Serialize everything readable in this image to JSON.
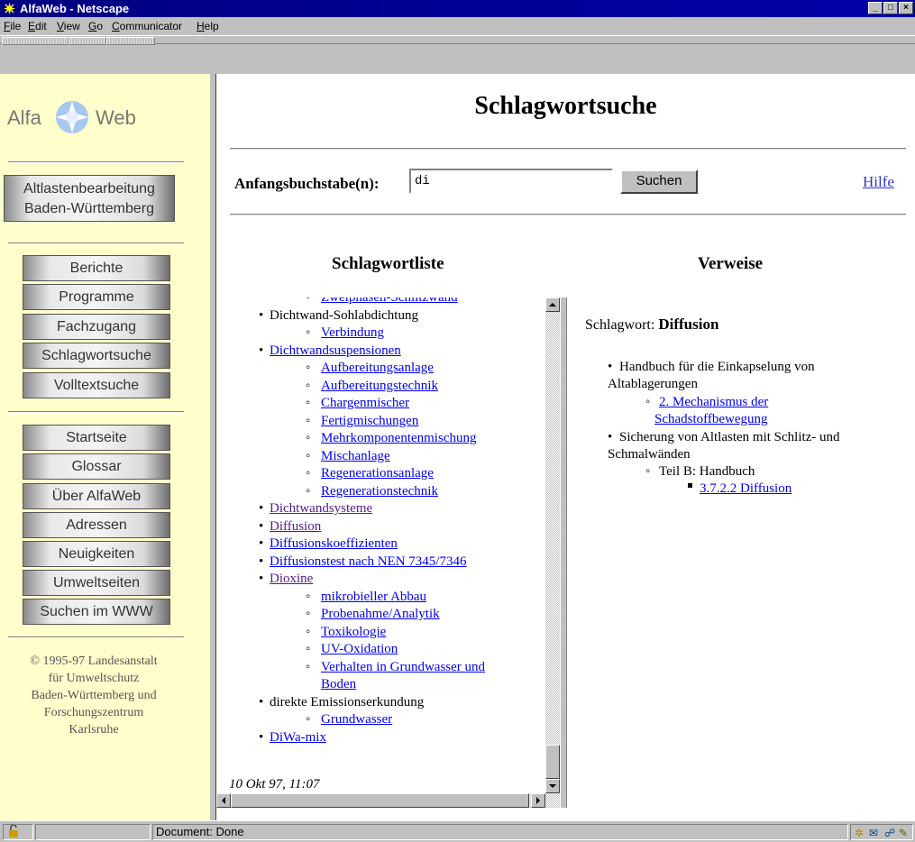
{
  "window": {
    "title": "AlfaWeb - Netscape",
    "buttons": [
      "_",
      "□",
      "×"
    ]
  },
  "menu": {
    "items": [
      "File",
      "Edit",
      "View",
      "Go",
      "Communicator",
      "Help"
    ]
  },
  "sidebar": {
    "logo_left": "Alfa",
    "logo_right": "Web",
    "project_button": [
      "Altlastenbearbeitung",
      "Baden-Württemberg"
    ],
    "group1": [
      "Berichte",
      "Programme",
      "Fachzugang",
      "Schlagwortsuche",
      "Volltextsuche"
    ],
    "group2": [
      "Startseite",
      "Glossar",
      "Über AlfaWeb",
      "Adressen",
      "Neuigkeiten",
      "Umweltseiten",
      "Suchen im WWW"
    ],
    "copyright": [
      "© 1995-97 Landesanstalt",
      "für Umweltschutz",
      "Baden-Württemberg und",
      "Forschungszentrum",
      "Karlsruhe"
    ]
  },
  "main": {
    "title": "Schlagwortsuche",
    "search_label": "Anfangsbuchstabe(n):",
    "search_value": "di",
    "search_button": "Suchen",
    "help_link": "Hilfe",
    "list_heading": "Schlagwortliste",
    "refs_heading": "Verweise"
  },
  "keyword_list": [
    {
      "text": "Zweiphasen-Schlitzwand",
      "level": 2,
      "link": true,
      "visited": false
    },
    {
      "text": "Dichtwand-Sohlabdichtung",
      "level": 1,
      "link": false,
      "visited": false
    },
    {
      "text": "Verbindung",
      "level": 2,
      "link": true,
      "visited": false
    },
    {
      "text": "Dichtwandsuspensionen",
      "level": 1,
      "link": true,
      "visited": false
    },
    {
      "text": "Aufbereitungsanlage",
      "level": 2,
      "link": true,
      "visited": false
    },
    {
      "text": "Aufbereitungstechnik",
      "level": 2,
      "link": true,
      "visited": false
    },
    {
      "text": "Chargenmischer",
      "level": 2,
      "link": true,
      "visited": false
    },
    {
      "text": "Fertigmischungen",
      "level": 2,
      "link": true,
      "visited": false
    },
    {
      "text": "Mehrkomponentenmischung",
      "level": 2,
      "link": true,
      "visited": false
    },
    {
      "text": "Mischanlage",
      "level": 2,
      "link": true,
      "visited": false
    },
    {
      "text": "Regenerationsanlage",
      "level": 2,
      "link": true,
      "visited": false
    },
    {
      "text": "Regenerationstechnik",
      "level": 2,
      "link": true,
      "visited": false
    },
    {
      "text": "Dichtwandsysteme",
      "level": 1,
      "link": true,
      "visited": true
    },
    {
      "text": "Diffusion",
      "level": 1,
      "link": true,
      "visited": true
    },
    {
      "text": "Diffusionskoeffizienten",
      "level": 1,
      "link": true,
      "visited": false
    },
    {
      "text": "Diffusionstest nach NEN 7345/7346",
      "level": 1,
      "link": true,
      "visited": false
    },
    {
      "text": "Dioxine",
      "level": 1,
      "link": true,
      "visited": true
    },
    {
      "text": "mikrobieller Abbau",
      "level": 2,
      "link": true,
      "visited": false
    },
    {
      "text": "Probenahme/Analytik",
      "level": 2,
      "link": true,
      "visited": false
    },
    {
      "text": "Toxikologie",
      "level": 2,
      "link": true,
      "visited": false
    },
    {
      "text": "UV-Oxidation",
      "level": 2,
      "link": true,
      "visited": false
    },
    {
      "text": "Verhalten in Grundwasser und",
      "level": 2,
      "link": true,
      "visited": false
    },
    {
      "text": "Boden",
      "level": 2,
      "link": true,
      "visited": false,
      "continuation": true
    },
    {
      "text": "direkte Emissionserkundung",
      "level": 1,
      "link": false,
      "visited": false
    },
    {
      "text": "Grundwasser",
      "level": 2,
      "link": true,
      "visited": false
    },
    {
      "text": "DiWa-mix",
      "level": 1,
      "link": true,
      "visited": false
    }
  ],
  "list_timestamp": "10 Okt 97, 11:07",
  "references": {
    "keyword_label": "Schlagwort:",
    "keyword": "Diffusion",
    "doc1_title": [
      "Handbuch für die Einkapselung von",
      "Altablagerungen"
    ],
    "doc1_link": [
      "2. Mechanismus der",
      "Schadstoffbewegung"
    ],
    "doc2_title": [
      "Sicherung von Altlasten mit Schlitz- und",
      "Schmalwänden"
    ],
    "doc2_part": "Teil B: Handbuch",
    "doc2_link": "3.7.2.2 Diffusion"
  },
  "status": {
    "text": "Document: Done"
  }
}
